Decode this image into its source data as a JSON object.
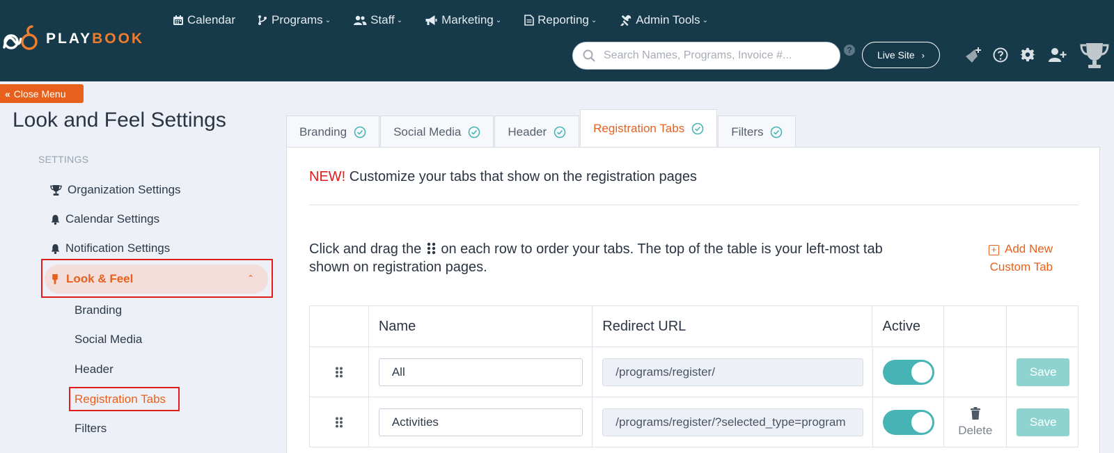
{
  "brand": {
    "play": "PLAY",
    "book": "BOOK"
  },
  "nav": [
    {
      "label": "Calendar",
      "icon": "calendar-icon"
    },
    {
      "label": "Programs",
      "icon": "branch-icon"
    },
    {
      "label": "Staff",
      "icon": "users-icon"
    },
    {
      "label": "Marketing",
      "icon": "megaphone-icon"
    },
    {
      "label": "Reporting",
      "icon": "document-icon"
    },
    {
      "label": "Admin Tools",
      "icon": "tools-icon"
    }
  ],
  "search": {
    "placeholder": "Search Names, Programs, Invoice #..."
  },
  "header": {
    "live_site": "Live Site",
    "help_glyph": "?"
  },
  "close_menu": "Close Menu",
  "page_title": "Look and Feel Settings",
  "sidebar": {
    "section": "SETTINGS",
    "items": [
      {
        "label": "Organization Settings",
        "icon": "trophy-icon"
      },
      {
        "label": "Calendar Settings",
        "icon": "bell-icon"
      },
      {
        "label": "Notification Settings",
        "icon": "bell-icon"
      }
    ],
    "active": "Look & Feel",
    "sub_items": [
      "Branding",
      "Social Media",
      "Header",
      "Registration Tabs",
      "Filters"
    ],
    "active_sub": "Registration Tabs"
  },
  "tabs": [
    "Branding",
    "Social Media",
    "Header",
    "Registration Tabs",
    "Filters"
  ],
  "active_tab": "Registration Tabs",
  "main": {
    "notice_new": "NEW!",
    "notice_text": " Customize your tabs that show on the registration pages",
    "instr_before": "Click and drag the ",
    "instr_after": " on each row to order your tabs. The top of the table is your left-most tab shown on registration pages.",
    "add_new": "Add New Custom Tab"
  },
  "table": {
    "headers": [
      "Name",
      "Redirect URL",
      "Active"
    ],
    "rows": [
      {
        "name": "All",
        "url": "/programs/register/",
        "active": true,
        "deletable": false,
        "save": "Save"
      },
      {
        "name": "Activities",
        "url": "/programs/register/?selected_type=program",
        "active": true,
        "deletable": true,
        "delete": "Delete",
        "save": "Save"
      }
    ]
  },
  "colors": {
    "accent": "#e8611c",
    "topbar": "#173a4a",
    "toggle": "#46b4b4",
    "highlight": "#e21b1b"
  }
}
